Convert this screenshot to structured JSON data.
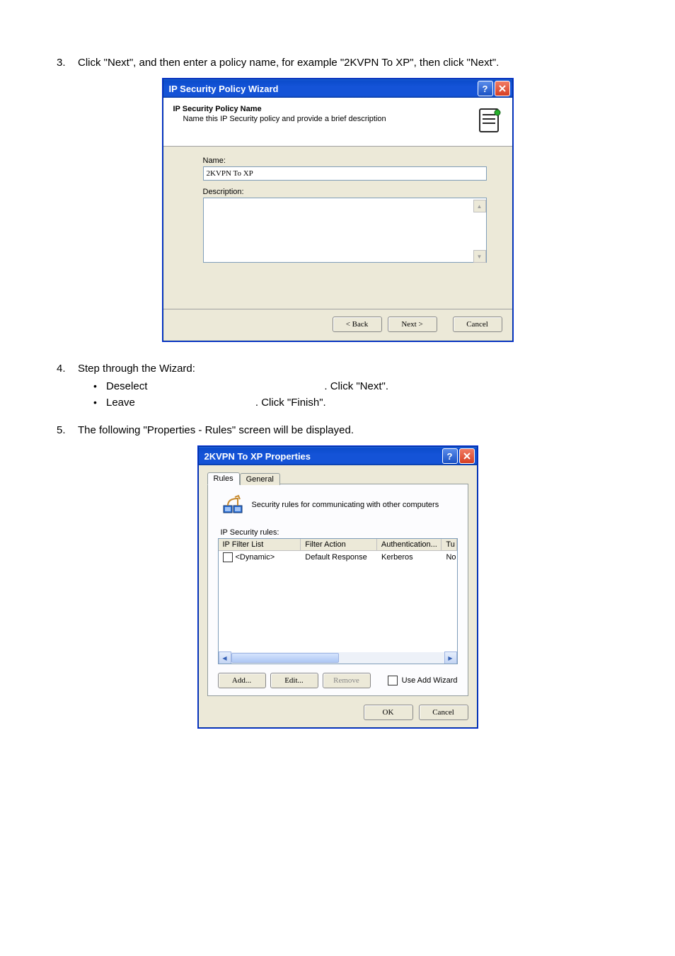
{
  "doc": {
    "step3": "Click \"Next\", and then enter a policy name, for example \"2KVPN To XP\", then click \"Next\".",
    "step4": "Step through the Wizard:",
    "step4a_1": "Deselect",
    "step4a_2": ". Click \"Next\".",
    "step4b_1": "Leave",
    "step4b_2": ". Click \"Finish\".",
    "step5": "The following \"Properties - Rules\" screen will be displayed."
  },
  "wizard": {
    "title": "IP Security Policy Wizard",
    "head_title": "IP Security Policy Name",
    "head_sub": "Name this IP Security policy and provide a brief description",
    "name_label": "Name:",
    "name_value": "2KVPN To XP",
    "desc_label": "Description:",
    "desc_value": "",
    "btn_back": "< Back",
    "btn_next": "Next >",
    "btn_cancel": "Cancel"
  },
  "props": {
    "title": "2KVPN To XP Properties",
    "tab_rules": "Rules",
    "tab_general": "General",
    "panel_text": "Security rules for communicating with other computers",
    "rules_label": "IP Security rules:",
    "columns": {
      "c1": "IP Filter List",
      "c2": "Filter Action",
      "c3": "Authentication...",
      "c4": "Tu"
    },
    "row": {
      "c1": "<Dynamic>",
      "c2": "Default Response",
      "c3": "Kerberos",
      "c4": "No"
    },
    "btn_add": "Add...",
    "btn_edit": "Edit...",
    "btn_remove": "Remove",
    "use_wizard": "Use Add Wizard",
    "btn_ok": "OK",
    "btn_cancel": "Cancel"
  }
}
